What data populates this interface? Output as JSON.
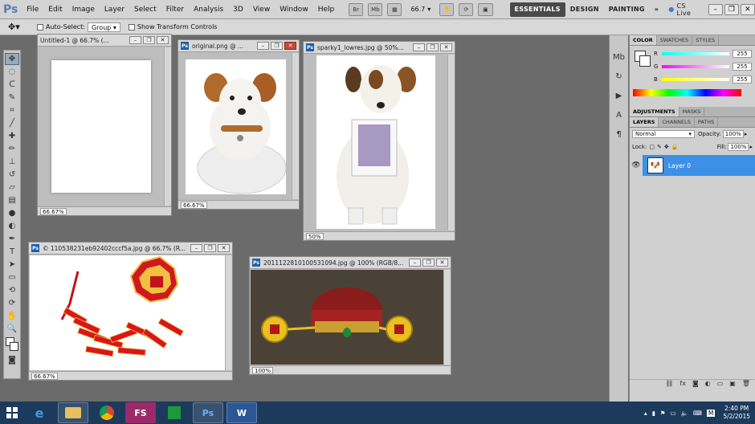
{
  "app": {
    "logo": "Ps"
  },
  "menu": [
    "File",
    "Edit",
    "Image",
    "Layer",
    "Select",
    "Filter",
    "Analysis",
    "3D",
    "View",
    "Window",
    "Help"
  ],
  "menubar": {
    "btn1": "Br",
    "btn2": "Mb",
    "zoom": "66.7",
    "workspaces": [
      "ESSENTIALS",
      "DESIGN",
      "PAINTING"
    ],
    "more": "»",
    "cslive": "CS Live"
  },
  "options": {
    "auto_select_label": "Auto-Select:",
    "auto_select_value": "Group",
    "transform_label": "Show Transform Controls"
  },
  "docs": [
    {
      "title": "Untitled-1 @ 66.7% (...",
      "zoom": "66.67%"
    },
    {
      "title": "original.png @ ...",
      "zoom": "66.67%"
    },
    {
      "title": "sparky1_lowres.jpg @ 50%...",
      "zoom": "50%"
    },
    {
      "title": "© 110538231eb92402cccf5a.jpg @ 66.7% (R...",
      "zoom": "66.67%"
    },
    {
      "title": "20111228101005310​94.jpg @ 100% (RGB/8...",
      "zoom": "100%"
    }
  ],
  "color_panel": {
    "tabs": [
      "COLOR",
      "SWATCHES",
      "STYLES"
    ],
    "r": "255",
    "g": "255",
    "b": "255",
    "r_label": "R",
    "g_label": "G",
    "b_label": "B"
  },
  "adjust_panel": {
    "tabs": [
      "ADJUSTMENTS",
      "MASKS"
    ]
  },
  "layers_panel": {
    "tabs": [
      "LAYERS",
      "CHANNELS",
      "PATHS"
    ],
    "blend": "Normal",
    "opacity_label": "Opacity:",
    "opacity": "100%",
    "lock_label": "Lock:",
    "fill_label": "Fill:",
    "fill": "100%",
    "layer_name": "Layer 0"
  },
  "taskbar": {
    "apps": [
      "e",
      "",
      "",
      "FS",
      "",
      "Ps",
      "W"
    ],
    "time": "2:40 PM",
    "date": "5/2/2015",
    "lang": "M"
  }
}
